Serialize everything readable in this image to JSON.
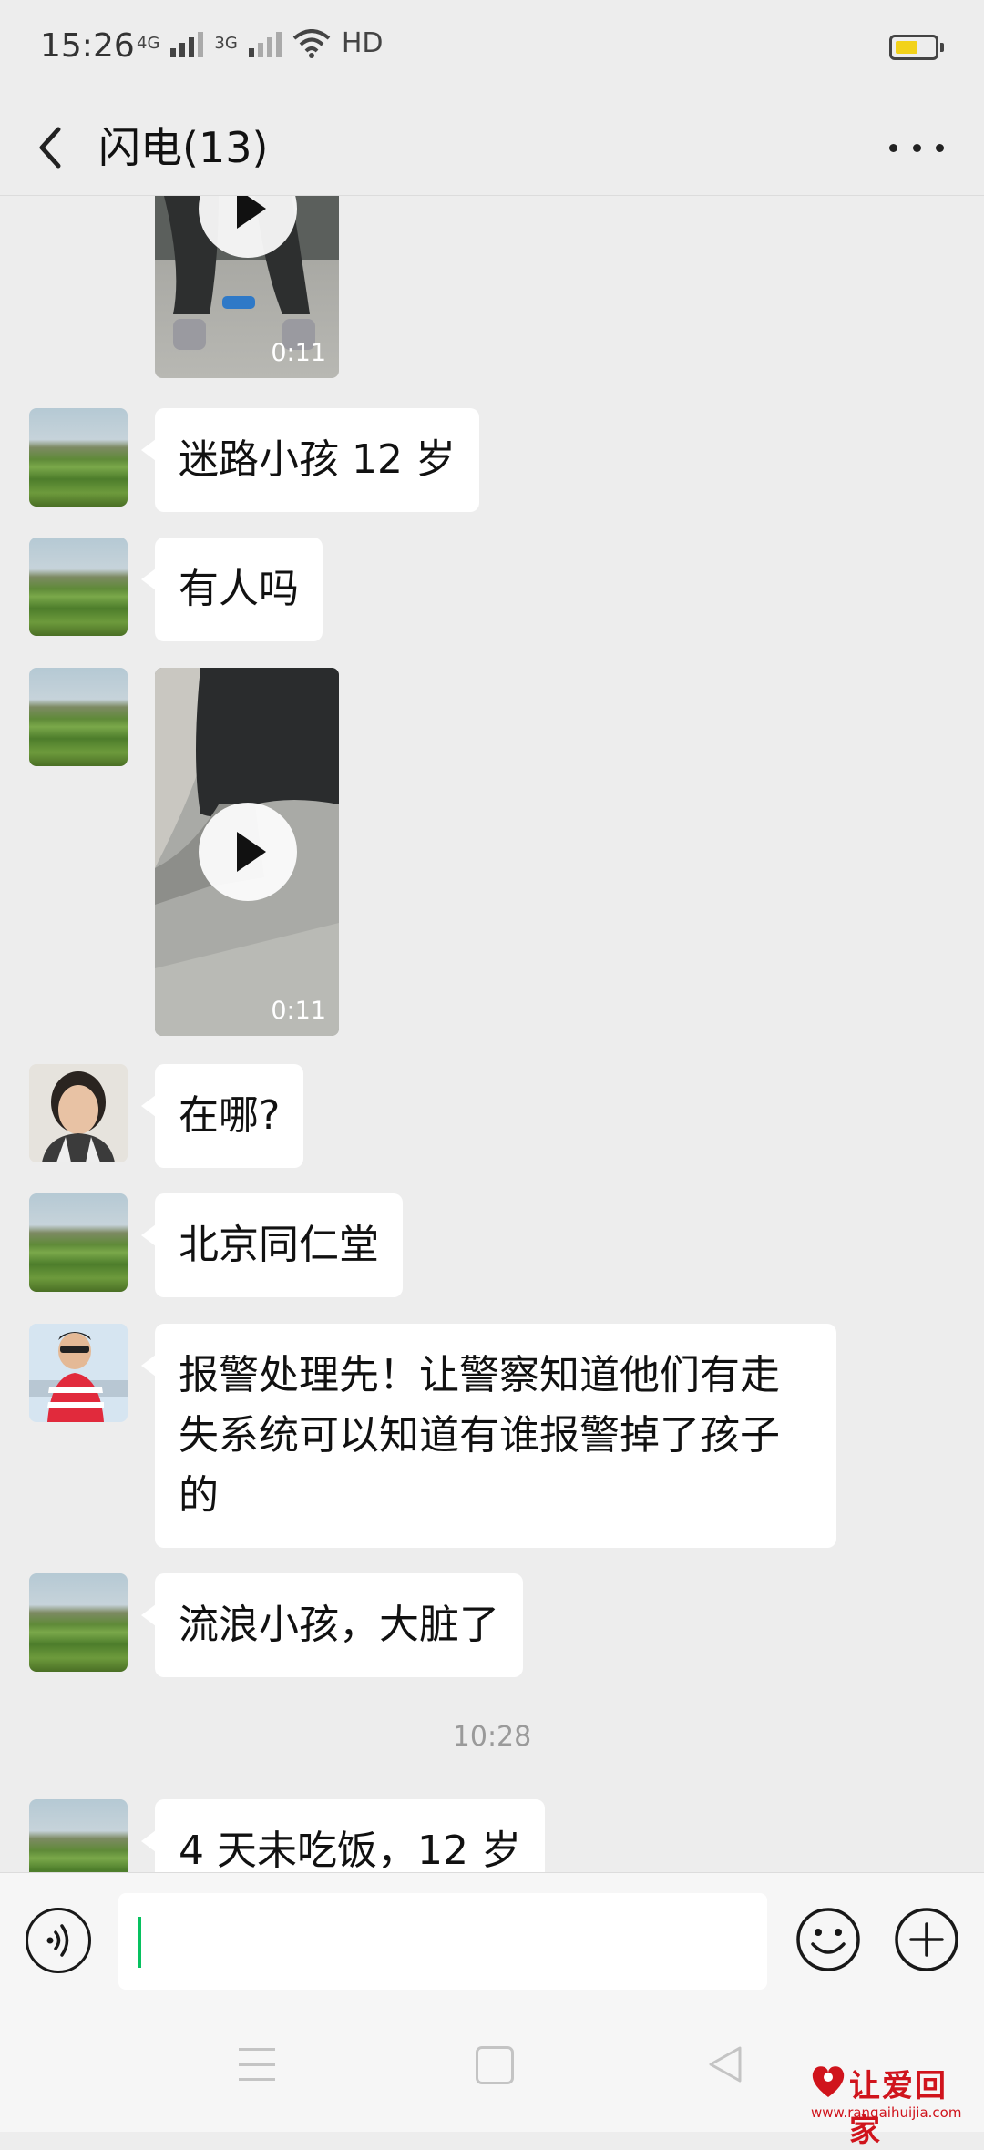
{
  "status_bar": {
    "time": "15:26",
    "network_1": "4G",
    "network_2": "3G",
    "hd": "HD",
    "battery_level": 0.6,
    "battery_color": "#f2d21a"
  },
  "header": {
    "title": "闪电(13)",
    "back_icon": "chevron-left-icon",
    "more_icon": "more-dots-icon"
  },
  "messages": [
    {
      "type": "video",
      "duration": "0:11"
    },
    {
      "type": "text",
      "text": "迷路小孩 12 岁"
    },
    {
      "type": "text",
      "text": "有人吗"
    },
    {
      "type": "video",
      "duration": "0:11"
    },
    {
      "type": "text",
      "text": "在哪?"
    },
    {
      "type": "text",
      "text": "北京同仁堂"
    },
    {
      "type": "text",
      "text": "报警处理先！让警察知道他们有走失系统可以知道有谁报警掉了孩子的"
    },
    {
      "type": "text",
      "text": "流浪小孩，大脏了"
    },
    {
      "type": "timestamp",
      "text": "10:28"
    },
    {
      "type": "text",
      "text": "4 天未吃饭，12 岁"
    }
  ],
  "input_bar": {
    "voice_icon": "voice-icon",
    "text_value": "",
    "emoji_icon": "emoji-icon",
    "plus_icon": "plus-icon",
    "accent": "#07c160"
  },
  "nav_bar": {
    "menu_icon": "menu-icon",
    "home_icon": "home-icon",
    "back_icon": "back-triangle-icon"
  },
  "watermark": {
    "title": "让爱回家",
    "url": "www.rangaihuijia.com",
    "color": "#d0141c"
  }
}
